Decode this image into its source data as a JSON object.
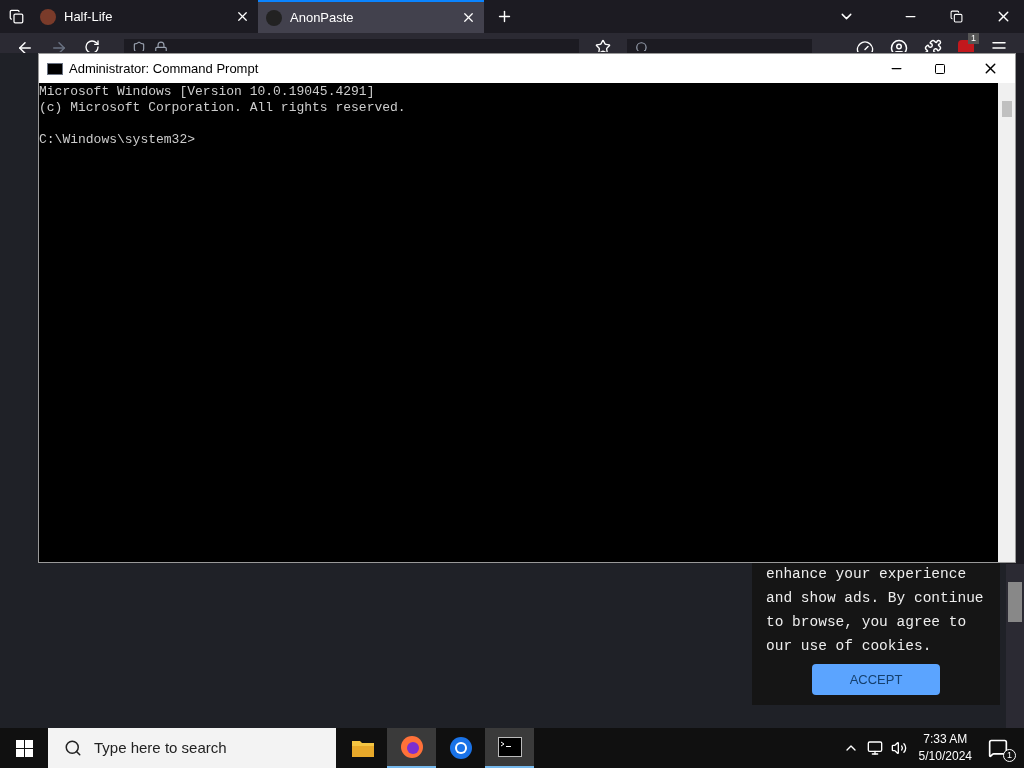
{
  "browser": {
    "tabs": [
      {
        "title": "Half-Life",
        "selected": false
      },
      {
        "title": "AnonPaste",
        "selected": true
      }
    ],
    "extension_badge": "1",
    "cookie_notice": {
      "text": "enhance your experience and show ads. By continue to browse, you agree to our use of cookies.",
      "button": "ACCEPT"
    }
  },
  "console_window": {
    "title": "Administrator: Command Prompt",
    "lines": [
      "Microsoft Windows [Version 10.0.19045.4291]",
      "(c) Microsoft Corporation. All rights reserved."
    ],
    "prompt": "C:\\Windows\\system32>"
  },
  "taskbar": {
    "search": {
      "placeholder": "Type here to search"
    },
    "apps": [
      {
        "kind": "folder",
        "active": false
      },
      {
        "kind": "firefox",
        "active": true
      },
      {
        "kind": "chrome",
        "active": false
      },
      {
        "kind": "terminal",
        "active": true
      }
    ],
    "time": "7:33 AM",
    "date": "5/10/2024",
    "notification_count": "1"
  }
}
